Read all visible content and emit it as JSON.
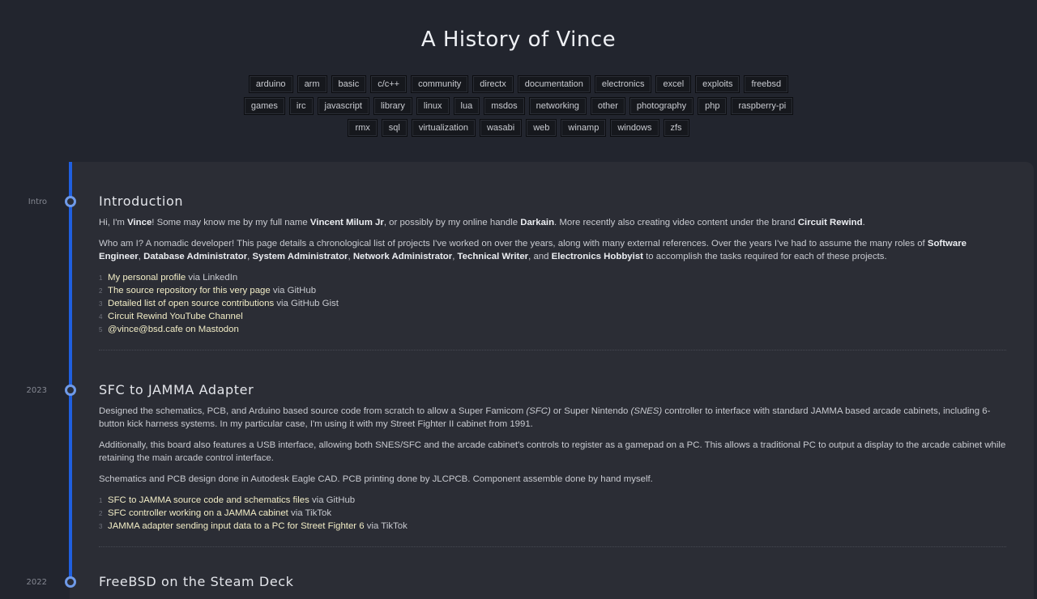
{
  "header": {
    "title": "A History of Vince"
  },
  "tags": [
    [
      "arduino",
      "arm",
      "basic",
      "c/c++",
      "community",
      "directx",
      "documentation",
      "electronics",
      "excel",
      "exploits",
      "freebsd"
    ],
    [
      "games",
      "irc",
      "javascript",
      "library",
      "linux",
      "lua",
      "msdos",
      "networking",
      "other",
      "photography",
      "php",
      "raspberry-pi"
    ],
    [
      "rmx",
      "sql",
      "virtualization",
      "wasabi",
      "web",
      "winamp",
      "windows",
      "zfs"
    ]
  ],
  "colors": {
    "accent": "#1f5fe0",
    "dot": "#6f9ae8",
    "link": "#f2edc6",
    "background": "#22252e",
    "panel": "#2b2d35"
  },
  "entries": [
    {
      "date": "Intro",
      "title": "Introduction",
      "paragraphs": [
        [
          {
            "t": "Hi, I'm "
          },
          {
            "t": "Vince",
            "b": true
          },
          {
            "t": "! Some may know me by my full name "
          },
          {
            "t": "Vincent Milum Jr",
            "b": true
          },
          {
            "t": ", or possibly by my online handle "
          },
          {
            "t": "Darkain",
            "b": true
          },
          {
            "t": ". More recently also creating video content under the brand "
          },
          {
            "t": "Circuit Rewind",
            "b": true
          },
          {
            "t": "."
          }
        ],
        [
          {
            "t": "Who am I? A nomadic developer! This page details a chronological list of projects I've worked on over the years, along with many external references. Over the years I've had to assume the many roles of "
          },
          {
            "t": "Software Engineer",
            "b": true
          },
          {
            "t": ", "
          },
          {
            "t": "Database Administrator",
            "b": true
          },
          {
            "t": ", "
          },
          {
            "t": "System Administrator",
            "b": true
          },
          {
            "t": ", "
          },
          {
            "t": "Network Administrator",
            "b": true
          },
          {
            "t": ", "
          },
          {
            "t": "Technical Writer",
            "b": true
          },
          {
            "t": ", and "
          },
          {
            "t": "Electronics Hobbyist",
            "b": true
          },
          {
            "t": " to accomplish the tasks required for each of these projects."
          }
        ]
      ],
      "links": [
        {
          "num": "1",
          "text": "My personal profile",
          "via": " via LinkedIn"
        },
        {
          "num": "2",
          "text": "The source repository for this very page",
          "via": " via GitHub"
        },
        {
          "num": "3",
          "text": "Detailed list of open source contributions",
          "via": " via GitHub Gist"
        },
        {
          "num": "4",
          "text": "Circuit Rewind YouTube Channel",
          "via": ""
        },
        {
          "num": "5",
          "text": "@vince@bsd.cafe on Mastodon",
          "via": ""
        }
      ]
    },
    {
      "date": "2023",
      "title": "SFC to JAMMA Adapter",
      "paragraphs": [
        [
          {
            "t": "Designed the schematics, PCB, and Arduino based source code from scratch to allow a Super Famicom "
          },
          {
            "t": "(SFC)",
            "i": true
          },
          {
            "t": " or Super Nintendo "
          },
          {
            "t": "(SNES)",
            "i": true
          },
          {
            "t": " controller to interface with standard JAMMA based arcade cabinets, including 6-button kick harness systems. In my particular case, I'm using it with my Street Fighter II cabinet from 1991."
          }
        ],
        [
          {
            "t": "Additionally, this board also features a USB interface, allowing both SNES/SFC and the arcade cabinet's controls to register as a gamepad on a PC. This allows a traditional PC to output a display to the arcade cabinet while retaining the main arcade control interface."
          }
        ],
        [
          {
            "t": "Schematics and PCB design done in Autodesk Eagle CAD. PCB printing done by JLCPCB. Component assemble done by hand myself."
          }
        ]
      ],
      "links": [
        {
          "num": "1",
          "text": "SFC to JAMMA source code and schematics files",
          "via": " via GitHub"
        },
        {
          "num": "2",
          "text": "SFC controller working on a JAMMA cabinet",
          "via": " via TikTok"
        },
        {
          "num": "3",
          "text": "JAMMA adapter sending input data to a PC for Street Fighter 6",
          "via": " via TikTok"
        }
      ]
    },
    {
      "date": "2022",
      "title": "FreeBSD on the Steam Deck",
      "paragraphs": [],
      "links": []
    }
  ]
}
